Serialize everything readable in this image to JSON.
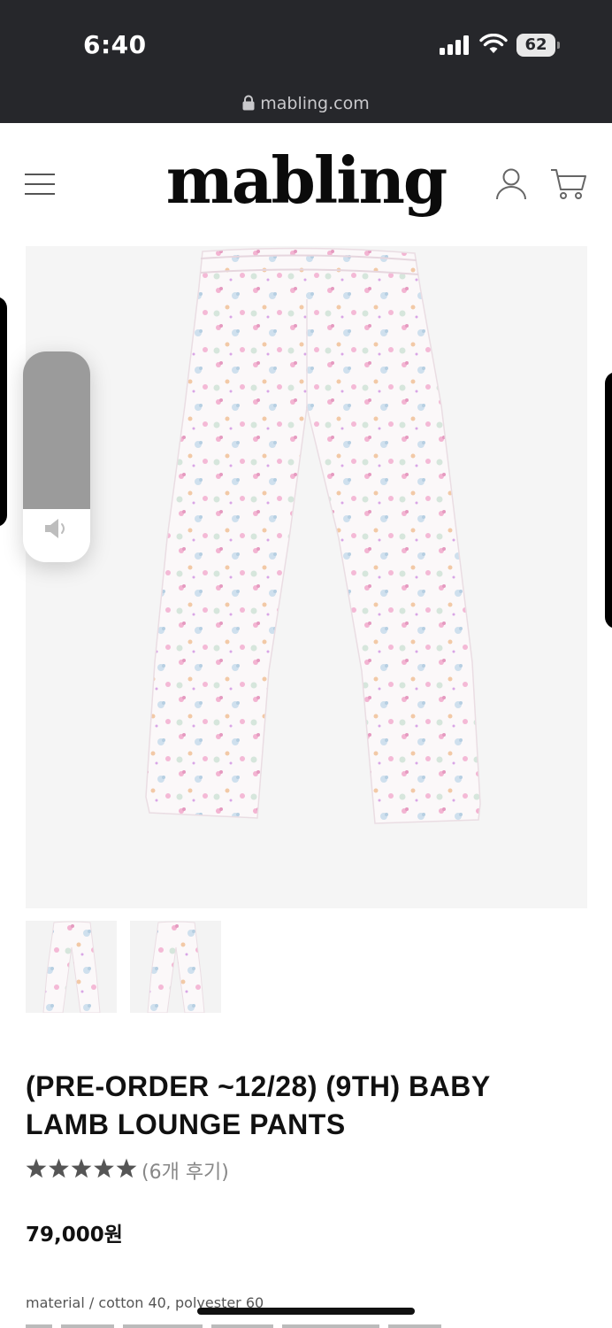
{
  "status_bar": {
    "time": "6:40",
    "battery": "62"
  },
  "browser": {
    "url": "mabling.com"
  },
  "header": {
    "logo": "mabling"
  },
  "product": {
    "title": "(PRE-ORDER ~12/28) (9TH) BABY LAMB LOUNGE PANTS",
    "rating": 5,
    "review_count": "(6개 후기)",
    "price": "79,000원",
    "material": "material / cotton 40, polyester 60"
  },
  "volume": {
    "level": 0.25
  },
  "colors": {
    "status_bar_bg": "#26272b",
    "accent": "#111111",
    "star": "#555555"
  }
}
